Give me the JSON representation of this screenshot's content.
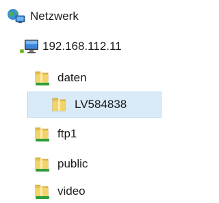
{
  "tree": {
    "network": {
      "label": "Netzwerk",
      "icon": "network-icon"
    },
    "computer": {
      "label": "192.168.112.11",
      "icon": "computer-icon"
    },
    "shares": [
      {
        "label": "daten",
        "icon": "shared-folder-icon",
        "selected": false
      },
      {
        "label": "LV584838",
        "icon": "folder-icon",
        "selected": true
      },
      {
        "label": "ftp1",
        "icon": "shared-folder-icon",
        "selected": false
      },
      {
        "label": "public",
        "icon": "shared-folder-icon",
        "selected": false
      },
      {
        "label": "video",
        "icon": "shared-folder-icon",
        "selected": false
      }
    ]
  },
  "colors": {
    "selection_bg": "#d9ebf9",
    "selection_border": "#b5d3ee",
    "folder_yellow": "#e8c14a",
    "share_green": "#2f9e3a"
  }
}
